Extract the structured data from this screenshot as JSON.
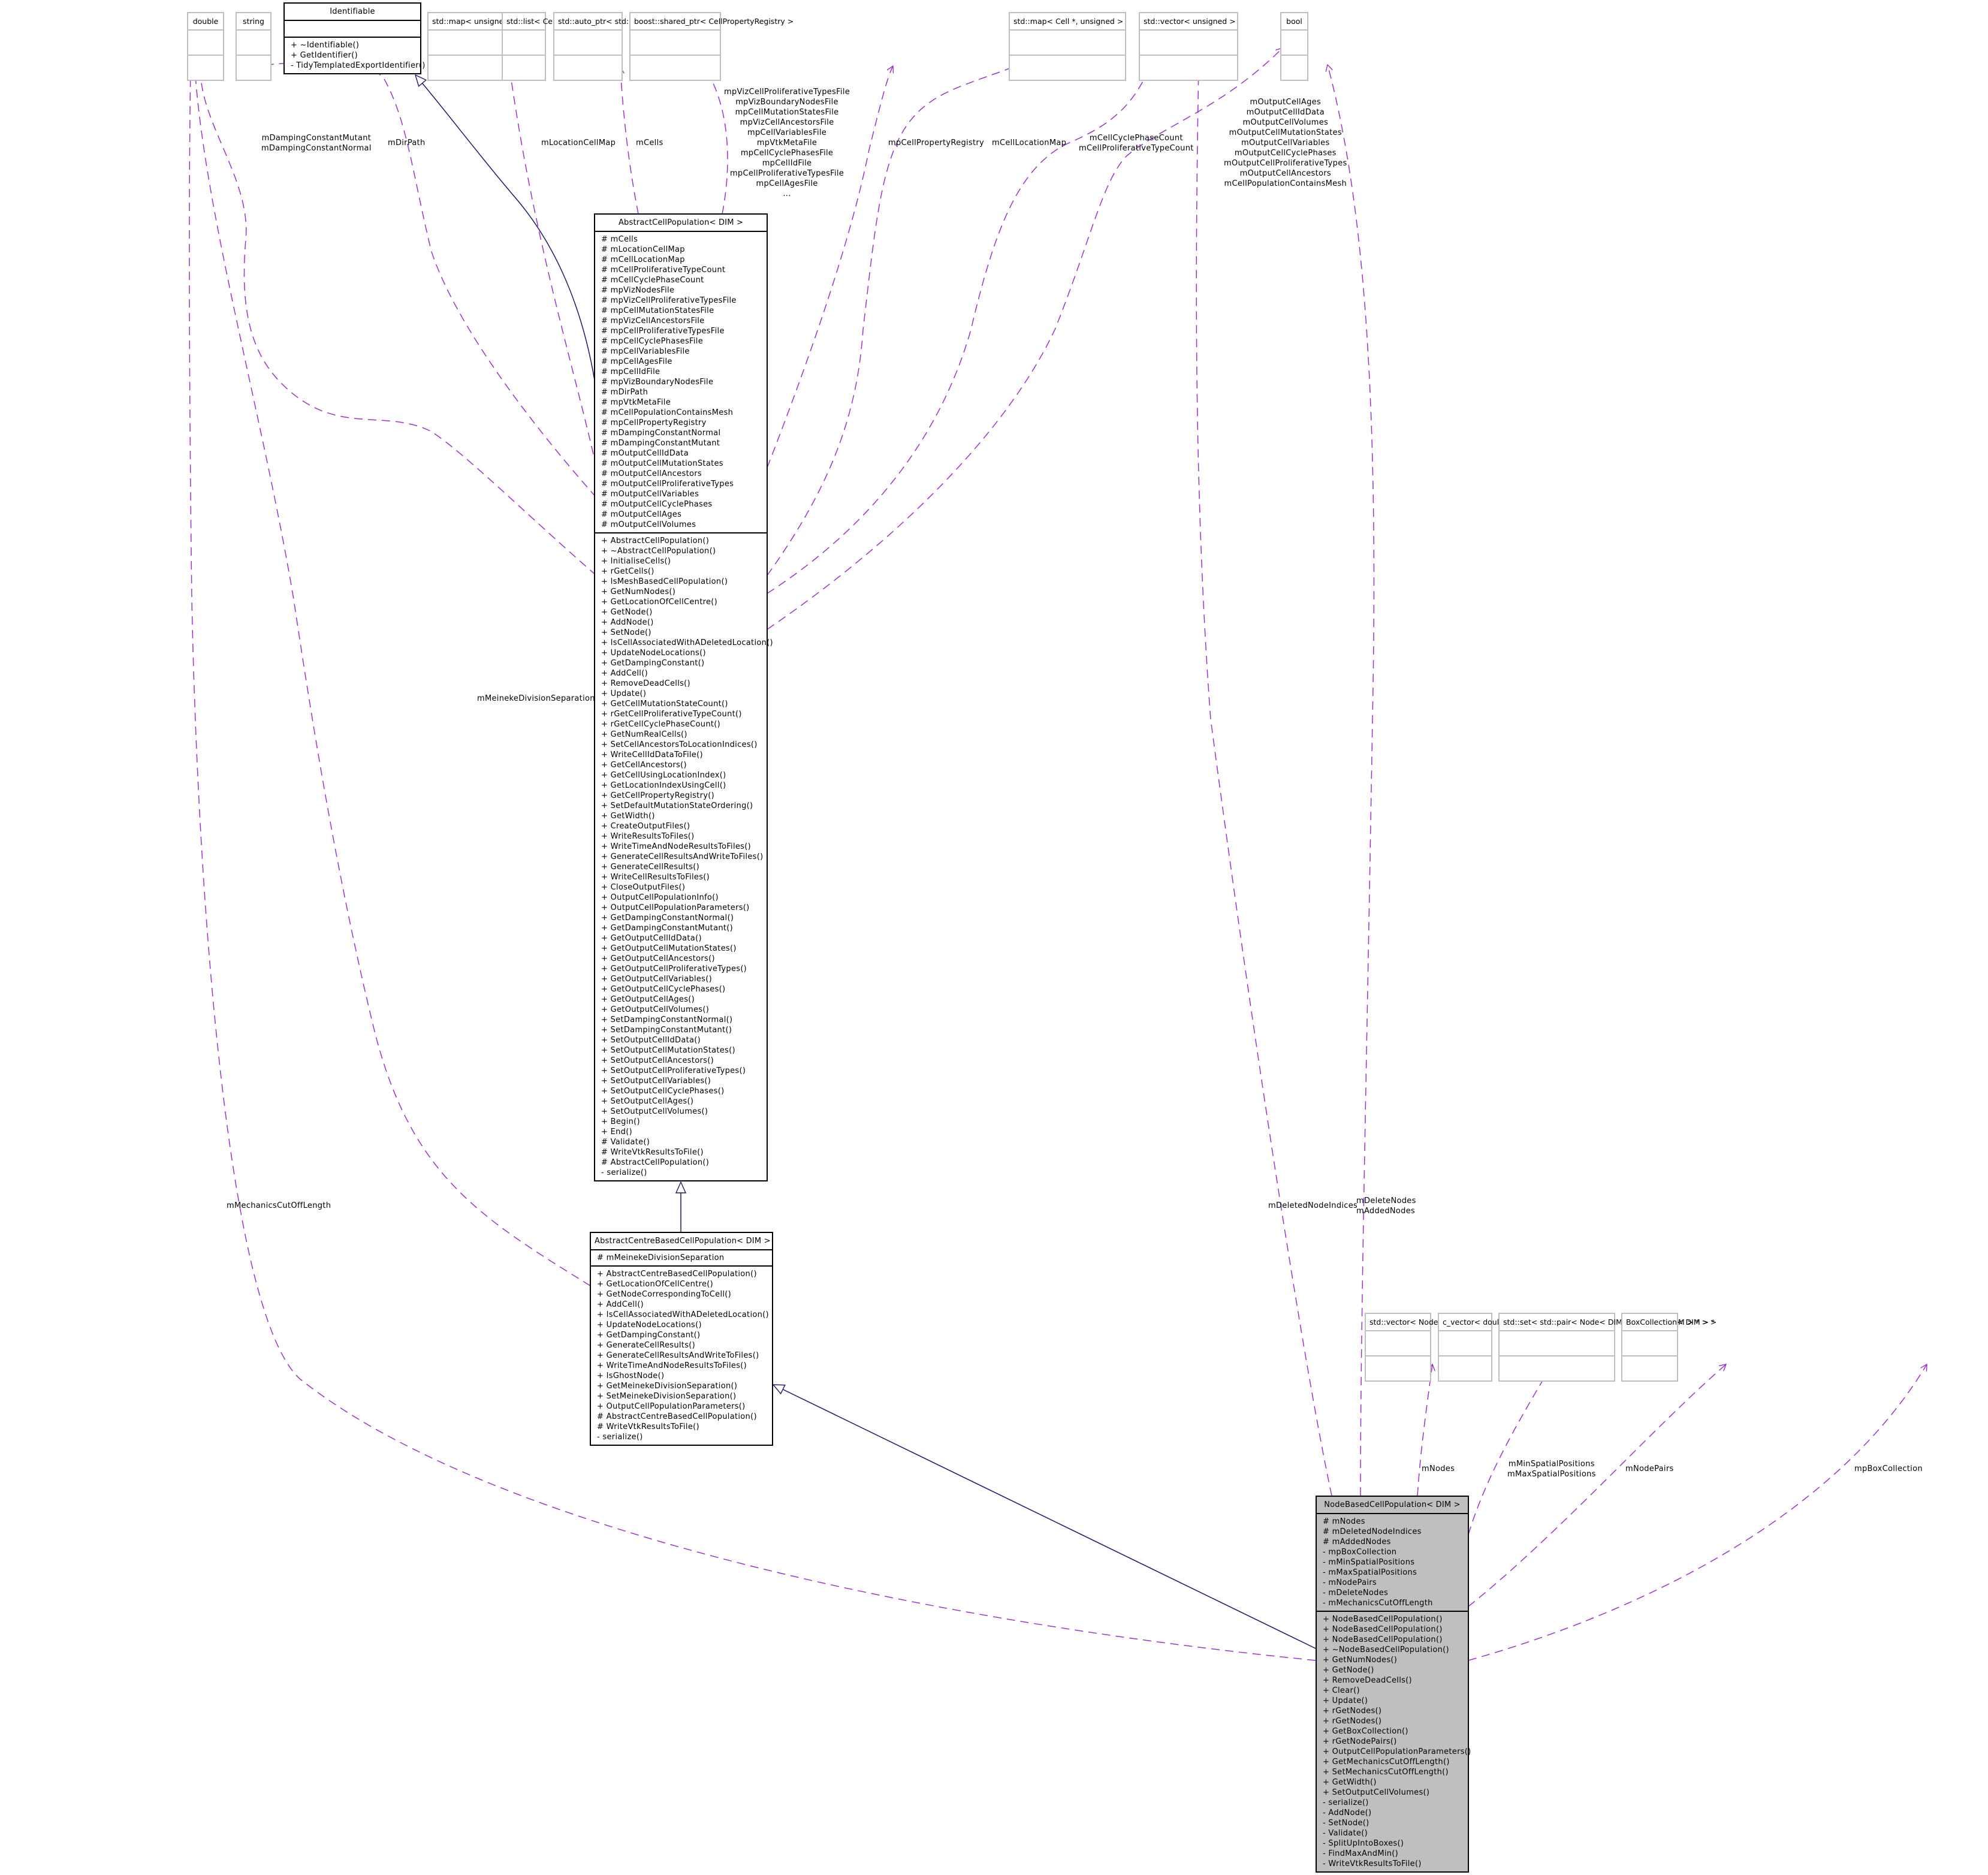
{
  "colors": {
    "usage_edge": "#9a32cd",
    "inherit_edge": "#191970",
    "focus_fill": "#bfbfbf",
    "undocumented_border": "#bfbfbf"
  },
  "classes": {
    "double": {
      "name": "double",
      "attributes": [],
      "methods": []
    },
    "string": {
      "name": "string",
      "attributes": [],
      "methods": []
    },
    "identifiable": {
      "name": "Identifiable",
      "attributes": [],
      "methods": [
        "+ ~Identifiable()",
        "+ GetIdentifier()",
        "- TidyTemplatedExportIdentifier()"
      ]
    },
    "map_unsigned_cellptr": {
      "name": "std::map< unsigned, CellPtr >",
      "attributes": [],
      "methods": []
    },
    "list_cellptr": {
      "name": "std::list< CellPtr >",
      "attributes": [],
      "methods": []
    },
    "auto_ptr_ofstream": {
      "name": "std::auto_ptr< std::ofstream >",
      "attributes": [],
      "methods": []
    },
    "shared_ptr_registry": {
      "name": "boost::shared_ptr< CellPropertyRegistry >",
      "attributes": [],
      "methods": []
    },
    "map_cell_unsigned": {
      "name": "std::map< Cell *, unsigned >",
      "attributes": [],
      "methods": []
    },
    "vector_unsigned": {
      "name": "std::vector< unsigned >",
      "attributes": [],
      "methods": []
    },
    "bool": {
      "name": "bool",
      "attributes": [],
      "methods": []
    },
    "abstract_cell_population": {
      "name": "AbstractCellPopulation< DIM >",
      "attributes": [
        "# mCells",
        "# mLocationCellMap",
        "# mCellLocationMap",
        "# mCellProliferativeTypeCount",
        "# mCellCyclePhaseCount",
        "# mpVizNodesFile",
        "# mpVizCellProliferativeTypesFile",
        "# mpCellMutationStatesFile",
        "# mpVizCellAncestorsFile",
        "# mpCellProliferativeTypesFile",
        "# mpCellCyclePhasesFile",
        "# mpCellVariablesFile",
        "# mpCellAgesFile",
        "# mpCellIdFile",
        "# mpVizBoundaryNodesFile",
        "# mDirPath",
        "# mpVtkMetaFile",
        "# mCellPopulationContainsMesh",
        "# mpCellPropertyRegistry",
        "# mDampingConstantNormal",
        "# mDampingConstantMutant",
        "# mOutputCellIdData",
        "# mOutputCellMutationStates",
        "# mOutputCellAncestors",
        "# mOutputCellProliferativeTypes",
        "# mOutputCellVariables",
        "# mOutputCellCyclePhases",
        "# mOutputCellAges",
        "# mOutputCellVolumes"
      ],
      "methods": [
        "+ AbstractCellPopulation()",
        "+ ~AbstractCellPopulation()",
        "+ InitialiseCells()",
        "+ rGetCells()",
        "+ IsMeshBasedCellPopulation()",
        "+ GetNumNodes()",
        "+ GetLocationOfCellCentre()",
        "+ GetNode()",
        "+ AddNode()",
        "+ SetNode()",
        "+ IsCellAssociatedWithADeletedLocation()",
        "+ UpdateNodeLocations()",
        "+ GetDampingConstant()",
        "+ AddCell()",
        "+ RemoveDeadCells()",
        "+ Update()",
        "+ GetCellMutationStateCount()",
        "+ rGetCellProliferativeTypeCount()",
        "+ rGetCellCyclePhaseCount()",
        "+ GetNumRealCells()",
        "+ SetCellAncestorsToLocationIndices()",
        "+ WriteCellIdDataToFile()",
        "+ GetCellAncestors()",
        "+ GetCellUsingLocationIndex()",
        "+ GetLocationIndexUsingCell()",
        "+ GetCellPropertyRegistry()",
        "+ SetDefaultMutationStateOrdering()",
        "+ GetWidth()",
        "+ CreateOutputFiles()",
        "+ WriteResultsToFiles()",
        "+ WriteTimeAndNodeResultsToFiles()",
        "+ GenerateCellResultsAndWriteToFiles()",
        "+ GenerateCellResults()",
        "+ WriteCellResultsToFiles()",
        "+ CloseOutputFiles()",
        "+ OutputCellPopulationInfo()",
        "+ OutputCellPopulationParameters()",
        "+ GetDampingConstantNormal()",
        "+ GetDampingConstantMutant()",
        "+ GetOutputCellIdData()",
        "+ GetOutputCellMutationStates()",
        "+ GetOutputCellAncestors()",
        "+ GetOutputCellProliferativeTypes()",
        "+ GetOutputCellVariables()",
        "+ GetOutputCellCyclePhases()",
        "+ GetOutputCellAges()",
        "+ GetOutputCellVolumes()",
        "+ SetDampingConstantNormal()",
        "+ SetDampingConstantMutant()",
        "+ SetOutputCellIdData()",
        "+ SetOutputCellMutationStates()",
        "+ SetOutputCellAncestors()",
        "+ SetOutputCellProliferativeTypes()",
        "+ SetOutputCellVariables()",
        "+ SetOutputCellCyclePhases()",
        "+ SetOutputCellAges()",
        "+ SetOutputCellVolumes()",
        "+ Begin()",
        "+ End()",
        "# Validate()",
        "# WriteVtkResultsToFile()",
        "# AbstractCellPopulation()",
        "- serialize()"
      ]
    },
    "abstract_centre_based": {
      "name": "AbstractCentreBasedCellPopulation< DIM >",
      "attributes": [
        "# mMeinekeDivisionSeparation"
      ],
      "methods": [
        "+ AbstractCentreBasedCellPopulation()",
        "+ GetLocationOfCellCentre()",
        "+ GetNodeCorrespondingToCell()",
        "+ AddCell()",
        "+ IsCellAssociatedWithADeletedLocation()",
        "+ UpdateNodeLocations()",
        "+ GetDampingConstant()",
        "+ GenerateCellResults()",
        "+ GenerateCellResultsAndWriteToFiles()",
        "+ WriteTimeAndNodeResultsToFiles()",
        "+ IsGhostNode()",
        "+ GetMeinekeDivisionSeparation()",
        "+ SetMeinekeDivisionSeparation()",
        "+ OutputCellPopulationParameters()",
        "# AbstractCentreBasedCellPopulation()",
        "# WriteVtkResultsToFile()",
        "- serialize()"
      ]
    },
    "node_based": {
      "name": "NodeBasedCellPopulation< DIM >",
      "attributes": [
        "# mNodes",
        "# mDeletedNodeIndices",
        "# mAddedNodes",
        "- mpBoxCollection",
        "- mMinSpatialPositions",
        "- mMaxSpatialPositions",
        "- mNodePairs",
        "- mDeleteNodes",
        "- mMechanicsCutOffLength"
      ],
      "methods": [
        "+ NodeBasedCellPopulation()",
        "+ NodeBasedCellPopulation()",
        "+ NodeBasedCellPopulation()",
        "+ ~NodeBasedCellPopulation()",
        "+ GetNumNodes()",
        "+ GetNode()",
        "+ RemoveDeadCells()",
        "+ Clear()",
        "+ Update()",
        "+ rGetNodes()",
        "+ rGetNodes()",
        "+ GetBoxCollection()",
        "+ rGetNodePairs()",
        "+ OutputCellPopulationParameters()",
        "+ GetMechanicsCutOffLength()",
        "+ SetMechanicsCutOffLength()",
        "+ GetWidth()",
        "+ SetOutputCellVolumes()",
        "- serialize()",
        "- AddNode()",
        "- SetNode()",
        "- Validate()",
        "- SplitUpIntoBoxes()",
        "- FindMaxAndMin()",
        "- WriteVtkResultsToFile()"
      ]
    },
    "vector_node_ptr": {
      "name": "std::vector< Node< DIM > * >",
      "attributes": [],
      "methods": []
    },
    "c_vector_double": {
      "name": "c_vector< double, DIM >",
      "attributes": [],
      "methods": []
    },
    "set_pair_node": {
      "name": "std::set< std::pair< Node< DIM > *, Node< DIM > * > >",
      "attributes": [],
      "methods": []
    },
    "box_collection": {
      "name": "BoxCollection< DIM > *",
      "attributes": [],
      "methods": []
    }
  },
  "edge_labels": {
    "damping": [
      "mDampingConstantMutant",
      "mDampingConstantNormal"
    ],
    "dirpath": [
      "mDirPath"
    ],
    "location_cell_map": [
      "mLocationCellMap"
    ],
    "cells": [
      "mCells"
    ],
    "ofstream_files": [
      "mpVizCellProliferativeTypesFile",
      "mpVizBoundaryNodesFile",
      "mpCellMutationStatesFile",
      "mpVizCellAncestorsFile",
      "mpCellVariablesFile",
      "mpVtkMetaFile",
      "mpCellCyclePhasesFile",
      "mpCellIdFile",
      "mpCellProliferativeTypesFile",
      "mpCellAgesFile",
      "..."
    ],
    "registry": [
      "mpCellPropertyRegistry"
    ],
    "cell_location_map": [
      "mCellLocationMap"
    ],
    "counts": [
      "mCellCyclePhaseCount",
      "mCellProliferativeTypeCount"
    ],
    "bool_outputs": [
      "mOutputCellAges",
      "mOutputCellIdData",
      "mOutputCellVolumes",
      "mOutputCellMutationStates",
      "mOutputCellVariables",
      "mOutputCellCyclePhases",
      "mOutputCellProliferativeTypes",
      "mOutputCellAncestors",
      "mCellPopulationContainsMesh"
    ],
    "meineke": [
      "mMeinekeDivisionSeparation"
    ],
    "mechanics": [
      "mMechanicsCutOffLength"
    ],
    "deleted_indices": [
      "mDeletedNodeIndices"
    ],
    "delete_added": [
      "mDeleteNodes",
      "mAddedNodes"
    ],
    "nodes": [
      "mNodes"
    ],
    "spatial": [
      "mMinSpatialPositions",
      "mMaxSpatialPositions"
    ],
    "node_pairs": [
      "mNodePairs"
    ],
    "box_collection": [
      "mpBoxCollection"
    ]
  }
}
